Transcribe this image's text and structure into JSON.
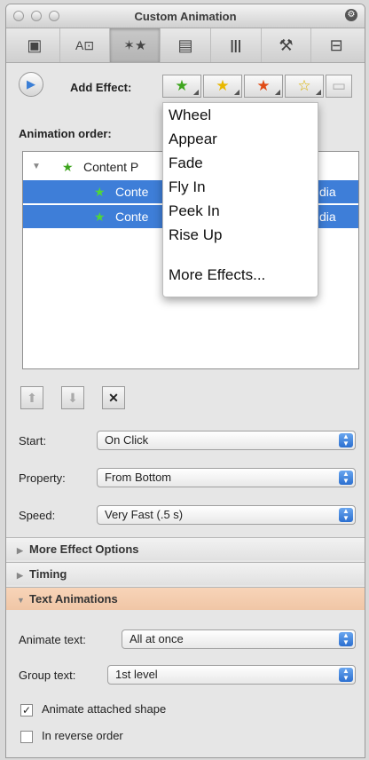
{
  "window": {
    "title": "Custom Animation"
  },
  "toolbar": {
    "tabs": [
      {
        "icon": "slide-icon",
        "glyph": "▣"
      },
      {
        "icon": "text-image-icon",
        "glyph": "A⊡"
      },
      {
        "icon": "animation-icon",
        "glyph": "✶★"
      },
      {
        "icon": "document-icon",
        "glyph": "▤"
      },
      {
        "icon": "library-icon",
        "glyph": "|||"
      },
      {
        "icon": "wrench-icon",
        "glyph": "🔧"
      },
      {
        "icon": "toolbox-icon",
        "glyph": "⊟"
      }
    ],
    "active_index": 2
  },
  "add_effect": {
    "label": "Add Effect:",
    "buttons": [
      {
        "icon": "entrance-effect-icon",
        "glyph": "★",
        "color": "#3ea51e"
      },
      {
        "icon": "emphasis-effect-icon",
        "glyph": "★",
        "color": "#e8b800"
      },
      {
        "icon": "exit-effect-icon",
        "glyph": "★",
        "color": "#e04a14"
      },
      {
        "icon": "motion-path-icon",
        "glyph": "☆",
        "color": "#d9b200"
      },
      {
        "icon": "media-icon",
        "glyph": "▭",
        "color": "#999999"
      }
    ]
  },
  "animation_order": {
    "label": "Animation order:",
    "items": [
      {
        "text": "Content P",
        "level": 0,
        "selected": false
      },
      {
        "text": "Conte",
        "suffix": "dia",
        "level": 1,
        "selected": true
      },
      {
        "text": "Conte",
        "suffix": "dia",
        "level": 1,
        "selected": true
      }
    ]
  },
  "effects_menu": {
    "items": [
      "Wheel",
      "Appear",
      "Fade",
      "Fly In",
      "Peek In",
      "Rise Up"
    ],
    "more": "More Effects..."
  },
  "start": {
    "label": "Start:",
    "value": "On Click"
  },
  "property": {
    "label": "Property:",
    "value": "From Bottom"
  },
  "speed": {
    "label": "Speed:",
    "value": "Very Fast (.5 s)"
  },
  "sections": {
    "more_options": "More Effect Options",
    "timing": "Timing",
    "text_animations": "Text Animations"
  },
  "animate_text": {
    "label": "Animate text:",
    "value": "All at once"
  },
  "group_text": {
    "label": "Group text:",
    "value": "1st level"
  },
  "animate_shape": {
    "label": "Animate attached shape",
    "checked": true
  },
  "reverse_order": {
    "label": "In reverse order",
    "checked": false
  }
}
